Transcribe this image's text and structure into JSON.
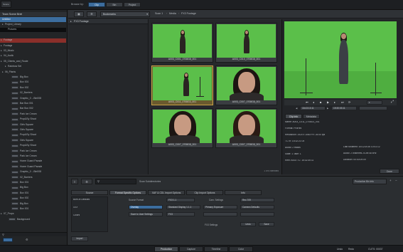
{
  "colors": {
    "accent_blue": "#3c6d9e",
    "selection_gold": "#c9a247",
    "greenscreen": "#5bbf4a",
    "folder_red": "#8a2f2a"
  },
  "topbar": {
    "browse_label": "Browse by:",
    "browse_options": [
      "Clip",
      "Bin",
      "Project"
    ]
  },
  "leftpanel": {
    "tab_label": "Scene",
    "header": "Team Scene Brief",
    "rows": [
      {
        "label": "Untitled",
        "indent": 2,
        "kind": "selected"
      },
      {
        "label": "Project_Library",
        "indent": 6,
        "kind": "plain"
      },
      {
        "label": "Pictures",
        "indent": 10,
        "kind": "dark"
      },
      {
        "label": "",
        "indent": 4,
        "kind": "blank"
      },
      {
        "label": "Footage",
        "indent": 4,
        "kind": "red"
      },
      {
        "label": "Footage",
        "indent": 4,
        "kind": "plain"
      },
      {
        "label": "03_Music",
        "indent": 4,
        "kind": "plain"
      },
      {
        "label": "04_Audio",
        "indent": 4,
        "kind": "plain"
      },
      {
        "label": "05_Clients_and_Route",
        "indent": 4,
        "kind": "plain"
      },
      {
        "label": "Rainbow Set",
        "indent": 10,
        "kind": "plain"
      },
      {
        "label": "06_Plants",
        "indent": 6,
        "kind": "plain"
      },
      {
        "label": "Big Box",
        "indent": 14,
        "kind": "thumb"
      },
      {
        "label": "Box 001",
        "indent": 14,
        "kind": "thumb"
      },
      {
        "label": "Box 002",
        "indent": 14,
        "kind": "thumb"
      },
      {
        "label": "02_Barriers",
        "indent": 14,
        "kind": "thumb"
      },
      {
        "label": "Graphic_0 ...Bin008",
        "indent": 14,
        "kind": "thumb"
      },
      {
        "label": "Bar Box 001",
        "indent": 14,
        "kind": "thumb"
      },
      {
        "label": "Bar Box 002",
        "indent": 14,
        "kind": "thumb"
      },
      {
        "label": "Park Ice Cream",
        "indent": 14,
        "kind": "thumb"
      },
      {
        "label": "Prop&Sy Shoot",
        "indent": 14,
        "kind": "thumb"
      },
      {
        "label": "Girls Square",
        "indent": 14,
        "kind": "thumb"
      },
      {
        "label": "Girls Square",
        "indent": 14,
        "kind": "thumb"
      },
      {
        "label": "Prop&Sy Shoot",
        "indent": 14,
        "kind": "thumb"
      },
      {
        "label": "Girls Square",
        "indent": 14,
        "kind": "thumb"
      },
      {
        "label": "Prop&Sy Shoot",
        "indent": 14,
        "kind": "thumb"
      },
      {
        "label": "Park Ice Cream",
        "indent": 14,
        "kind": "thumb"
      },
      {
        "label": "Park Ice Cream",
        "indent": 14,
        "kind": "thumb"
      },
      {
        "label": "Home Guard Parade",
        "indent": 14,
        "kind": "thumb"
      },
      {
        "label": "Home Guard Parade",
        "indent": 14,
        "kind": "thumb"
      },
      {
        "label": "Graphic_0 ...Bin008",
        "indent": 14,
        "kind": "thumb"
      },
      {
        "label": "02_Barriers",
        "indent": 14,
        "kind": "thumb"
      },
      {
        "label": "Box 001",
        "indent": 14,
        "kind": "thumb"
      },
      {
        "label": "Big Box",
        "indent": 14,
        "kind": "thumb"
      },
      {
        "label": "Box 001",
        "indent": 14,
        "kind": "thumb"
      },
      {
        "label": "Box 002",
        "indent": 14,
        "kind": "thumb"
      },
      {
        "label": "Big Box",
        "indent": 14,
        "kind": "thumb"
      },
      {
        "label": "Box 001",
        "indent": 14,
        "kind": "thumb"
      },
      {
        "label": "07_Props",
        "indent": 4,
        "kind": "plain"
      },
      {
        "label": "Background",
        "indent": 10,
        "kind": "thumb"
      }
    ]
  },
  "toolbar": {
    "filter_label": "Bookmarks",
    "crumbs": [
      "Scan 1",
      "Media",
      "FX3 Footage"
    ]
  },
  "folderpane": {
    "header": "FX3 Footage"
  },
  "clips": [
    {
      "name": "A003_C001_0708G8_001",
      "selected": false,
      "kind": "full"
    },
    {
      "name": "A003_C010_0708G8_001",
      "selected": false,
      "kind": "full"
    },
    {
      "name": "A003_C011_0708G3_001",
      "selected": true,
      "kind": "wide"
    },
    {
      "name": "A003_C007_0708G8_001",
      "selected": false,
      "kind": "close"
    },
    {
      "name": "A003_C007_0708G8_001",
      "selected": false,
      "kind": "close2"
    },
    {
      "name": "A003_C007_0708G8_001",
      "selected": false,
      "kind": "close3"
    }
  ],
  "clip_count": "1 of 6 selected",
  "viewer": {
    "timecode_in": "18:43:13:11",
    "timecode_out": "19:30:03:11",
    "tabs": [
      "Clip Info",
      "Metadata"
    ],
    "info_rows": [
      "Name: A003_C011_0708G3_001",
      "Format: ProRes",
      "Resolution: 1920 x 1080  FR: 25.00 fps",
      "TC In: 15:32:21:04",
      "Audio: 2 tracks",
      "Slate: 1  Take: 1",
      "Reel: A003  TC: 15:32:30:11"
    ],
    "info_right": [
      "Last Modified: 10/12/2016 10:41:12",
      "Audio: 2 channels  24-bit 48 kHz",
      "Duration: 00:00:09:09"
    ],
    "done_label": "Done"
  },
  "inspector": {
    "search_placeholder": "",
    "scan_label": "Scan Subdirectories",
    "preset_label": "Production Bin Info",
    "tabs": [
      "Source",
      "Format Specific Options",
      "XAF & CDL Import Options",
      "Clip Import Options",
      "Info"
    ],
    "left_items": [
      "Burn-In Defaults",
      "XXX",
      "Colors"
    ],
    "source_label": "Source Format",
    "source_value": "FX3 1.1",
    "overlay_label": "Overlay",
    "overlay_value": "Standard Display 1.1.1",
    "user_label": "Save to User Settings",
    "user_value": "FX3",
    "cam_settings_label": "Cam. Settings",
    "camera_settings": [
      "Primary Exposure",
      "Camera Defaults"
    ],
    "gamma_value": "Rec.709",
    "lut_label": "FX3 Settings",
    "undo_label": "Undo",
    "save_label": "Save",
    "import_label": "Import"
  },
  "footer": {
    "tabs": [
      "Production",
      "Capture",
      "Timeline",
      "Color"
    ],
    "active_tab": "Production",
    "right_items": [
      "Undo",
      "Redo",
      "CUTS: 00037"
    ]
  }
}
